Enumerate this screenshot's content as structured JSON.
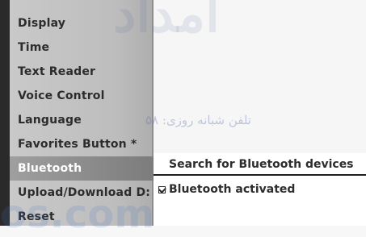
{
  "menu": {
    "items": [
      {
        "label": "Display"
      },
      {
        "label": "Time"
      },
      {
        "label": "Text Reader"
      },
      {
        "label": "Voice Control"
      },
      {
        "label": "Language"
      },
      {
        "label": "Favorites Button *"
      },
      {
        "label": "Bluetooth"
      },
      {
        "label": "Upload/Download D:"
      },
      {
        "label": "Reset"
      }
    ],
    "selected_index": 6
  },
  "submenu": {
    "search_label": "Search for Bluetooth devices",
    "activated_label": "Bluetooth activated",
    "activated_checked": true
  },
  "watermark": {
    "top_text": "امداد",
    "middle_text": "تلفن شبانه روزی: ۵۸",
    "bottom_text": "os.com"
  },
  "colors": {
    "menu_bg": "#c4c4c4",
    "selected_bg": "#8a8a8a",
    "selected_text": "#ffffff",
    "submenu_bg": "#ffffff"
  }
}
